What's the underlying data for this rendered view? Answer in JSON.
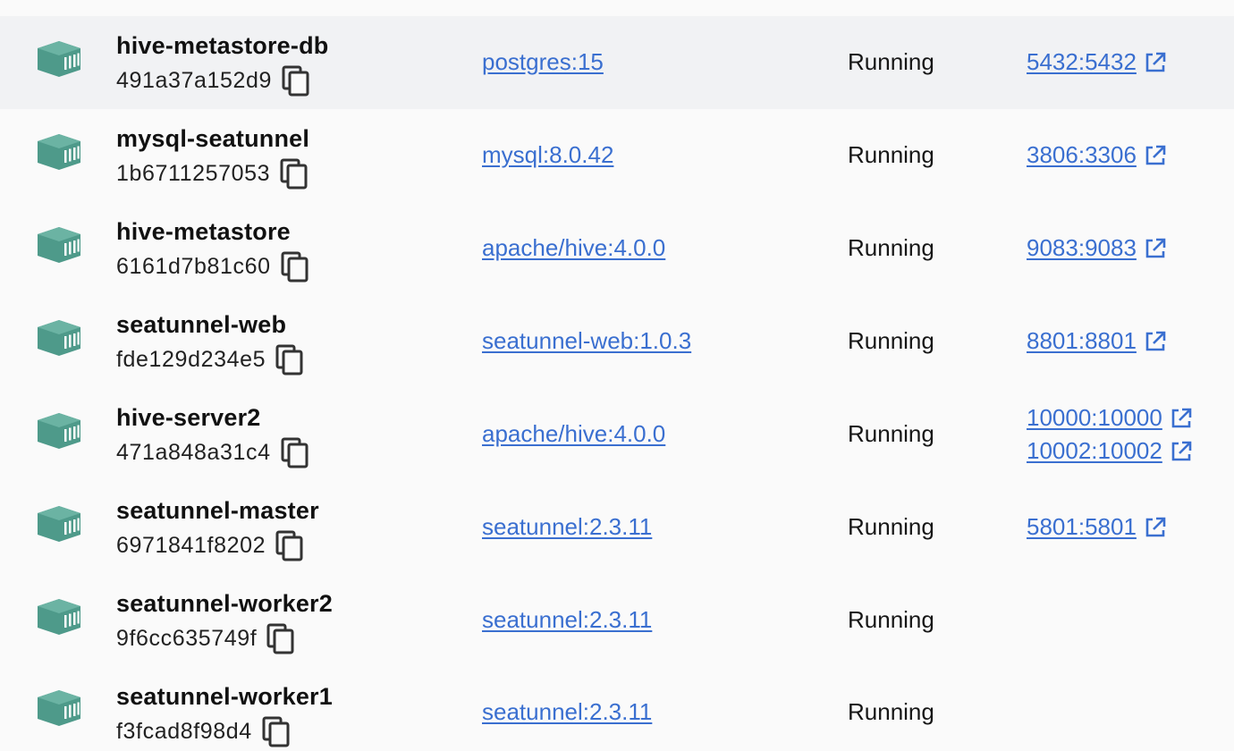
{
  "colors": {
    "link": "#3a6fd0",
    "container_icon": "#4e9a8a",
    "selected_row_bg": "#f1f2f4"
  },
  "rows": [
    {
      "name": "hive-metastore-db",
      "id": "491a37a152d9",
      "image": "postgres:15",
      "status": "Running",
      "ports": [
        "5432:5432"
      ],
      "selected": true
    },
    {
      "name": "mysql-seatunnel",
      "id": "1b6711257053",
      "image": "mysql:8.0.42",
      "status": "Running",
      "ports": [
        "3806:3306"
      ]
    },
    {
      "name": "hive-metastore",
      "id": "6161d7b81c60",
      "image": "apache/hive:4.0.0",
      "status": "Running",
      "ports": [
        "9083:9083"
      ]
    },
    {
      "name": "seatunnel-web",
      "id": "fde129d234e5",
      "image": "seatunnel-web:1.0.3",
      "status": "Running",
      "ports": [
        "8801:8801"
      ]
    },
    {
      "name": "hive-server2",
      "id": "471a848a31c4",
      "image": "apache/hive:4.0.0",
      "status": "Running",
      "ports": [
        "10000:10000",
        "10002:10002"
      ]
    },
    {
      "name": "seatunnel-master",
      "id": "6971841f8202",
      "image": "seatunnel:2.3.11",
      "status": "Running",
      "ports": [
        "5801:5801"
      ]
    },
    {
      "name": "seatunnel-worker2",
      "id": "9f6cc635749f",
      "image": "seatunnel:2.3.11",
      "status": "Running",
      "ports": []
    },
    {
      "name": "seatunnel-worker1",
      "id": "f3fcad8f98d4",
      "image": "seatunnel:2.3.11",
      "status": "Running",
      "ports": []
    }
  ]
}
